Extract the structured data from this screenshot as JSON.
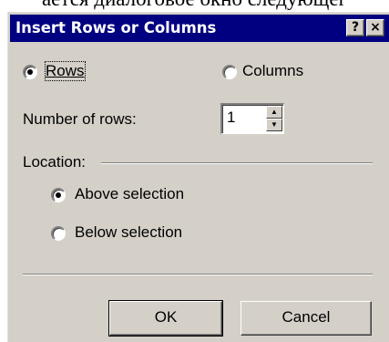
{
  "background": {
    "caption_fragment": "ается диалоговое окно следующег"
  },
  "dialog": {
    "title": "Insert Rows or Columns",
    "help_button": "?",
    "close_button": "×",
    "insert_type": {
      "rows_label": "Rows",
      "columns_label": "Columns",
      "selected": "Rows"
    },
    "number_of_rows": {
      "label": "Number of rows:",
      "value": "1",
      "up_arrow": "▲",
      "down_arrow": "▼"
    },
    "location": {
      "label": "Location:",
      "above_label": "Above selection",
      "below_label": "Below selection",
      "selected": "Above selection"
    },
    "buttons": {
      "ok": "OK",
      "cancel": "Cancel"
    }
  },
  "colors": {
    "title_bar": "#000080",
    "face": "#d4d0c8",
    "shadow": "#808080",
    "highlight": "#ffffff"
  }
}
